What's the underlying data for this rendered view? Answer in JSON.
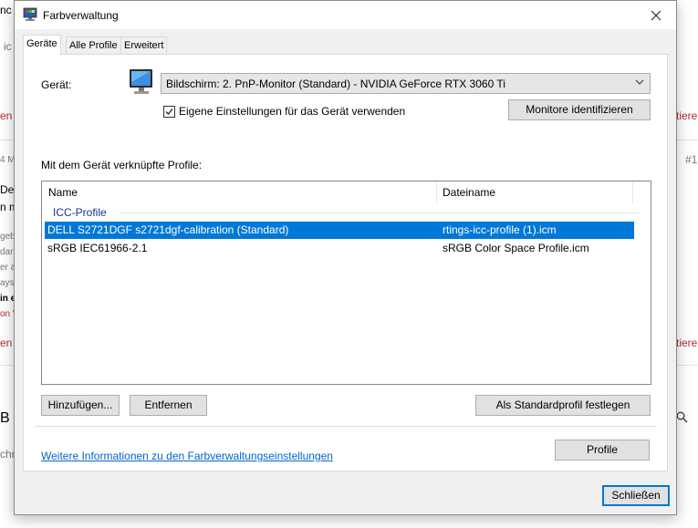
{
  "background_page": {
    "fragments_left": [
      "nc",
      "ic",
      "en",
      "4 M",
      "Del",
      "n m",
      "geb",
      "dar",
      "er a",
      "ays",
      "in e",
      "on \"",
      "en",
      "B",
      "chr"
    ],
    "fragments_right": [
      "tiere",
      "#1",
      "tiere"
    ]
  },
  "window": {
    "title": "Farbverwaltung",
    "tabs": [
      {
        "label": "Geräte",
        "active": true
      },
      {
        "label": "Alle Profile",
        "active": false
      },
      {
        "label": "Erweitert",
        "active": false
      }
    ]
  },
  "device": {
    "label": "Gerät:",
    "selected": "Bildschirm: 2. PnP-Monitor (Standard) - NVIDIA GeForce RTX 3060 Ti",
    "use_own_settings": {
      "label": "Eigene Einstellungen für das Gerät verwenden",
      "checked": true
    },
    "identify_button": "Monitore identifizieren"
  },
  "profiles": {
    "heading": "Mit dem Gerät verknüpfte Profile:",
    "columns": [
      "Name",
      "Dateiname"
    ],
    "group": "ICC-Profile",
    "rows": [
      {
        "name": "DELL S2721DGF s2721dgf-calibration (Standard)",
        "file": "rtings-icc-profile (1).icm",
        "selected": true
      },
      {
        "name": "sRGB IEC61966-2.1",
        "file": "sRGB Color Space Profile.icm",
        "selected": false
      }
    ],
    "add_button": "Hinzufügen...",
    "remove_button": "Entfernen",
    "set_default_button": "Als Standardprofil festlegen"
  },
  "footer": {
    "more_info_link": "Weitere Informationen zu den Farbverwaltungseinstellungen",
    "profile_button": "Profile",
    "close_button": "Schließen"
  },
  "colors": {
    "accent": "#0078d7",
    "link": "#0066cc",
    "group": "#1e3287"
  }
}
